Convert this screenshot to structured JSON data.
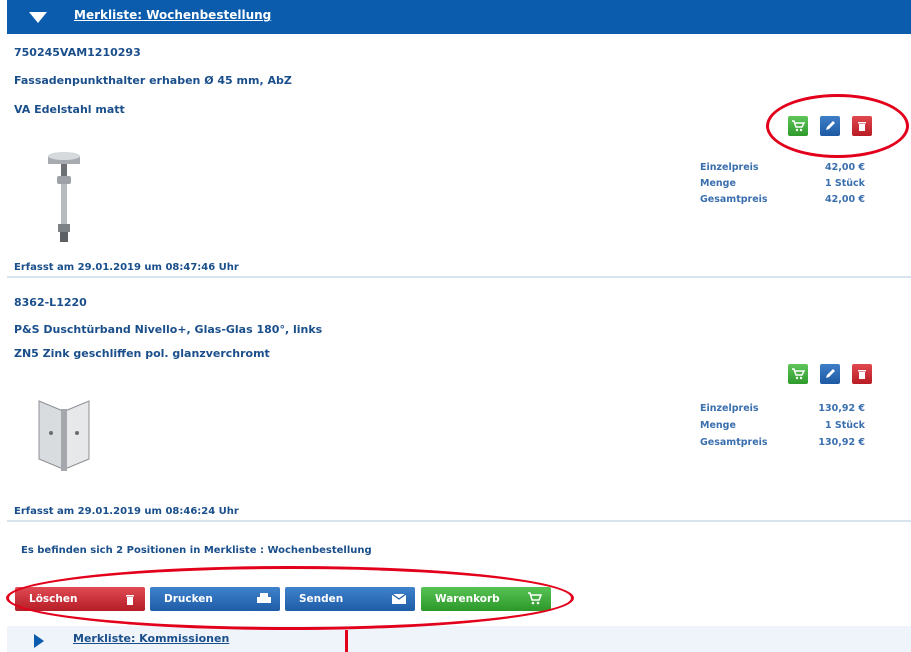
{
  "header": {
    "title": "Merkliste: Wochenbestellung"
  },
  "items": [
    {
      "article_number": "750245VAM1210293",
      "description": "Fassadenpunkthalter erhaben Ø 45 mm, AbZ",
      "material": "VA Edelstahl matt",
      "prices": [
        {
          "label": "Einzelpreis",
          "value": "42,00 €"
        },
        {
          "label": "Menge",
          "value": "1 Stück"
        },
        {
          "label": "Gesamtpreis",
          "value": "42,00 €"
        }
      ],
      "captured": "Erfasst am  29.01.2019  um  08:47:46  Uhr",
      "image": "point-holder-image"
    },
    {
      "article_number": "8362-L1220",
      "description": "P&S Duschtürband Nivello+, Glas-Glas 180°, links",
      "material": "ZN5 Zink geschliffen pol. glanzverchromt",
      "prices": [
        {
          "label": "Einzelpreis",
          "value": "130,92 €"
        },
        {
          "label": "Menge",
          "value": "1 Stück"
        },
        {
          "label": "Gesamtpreis",
          "value": "130,92 €"
        }
      ],
      "captured": "Erfasst am  29.01.2019  um  08:46:24  Uhr",
      "image": "shower-hinge-image"
    }
  ],
  "item_actions": {
    "cart_icon": "cart-icon",
    "edit_icon": "pencil-icon",
    "delete_icon": "trash-icon"
  },
  "summary": "Es befinden sich 2 Positionen in Merkliste : Wochenbestellung",
  "buttons": {
    "delete": "Löschen",
    "print": "Drucken",
    "send": "Senden",
    "cart": "Warenkorb"
  },
  "footer": {
    "title": "Merkliste: Kommissionen"
  },
  "colors": {
    "header_blue": "#0b5cac",
    "text_blue": "#1a4f8b",
    "cart_green": "#2f9a2c",
    "edit_blue": "#1e5aa3",
    "delete_red": "#b81d26",
    "highlight_red": "#e3001b"
  }
}
